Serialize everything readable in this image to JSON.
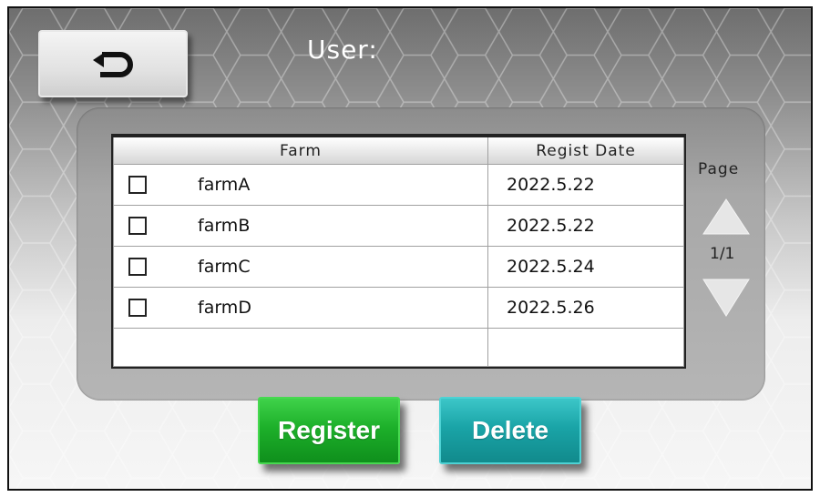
{
  "header": {
    "user_label": "User:"
  },
  "back_button": {
    "icon": "return-arrow-icon"
  },
  "table": {
    "columns": [
      "Farm",
      "Regist Date"
    ],
    "rows": [
      {
        "farm": "farmA",
        "date": "2022.5.22",
        "checked": false
      },
      {
        "farm": "farmB",
        "date": "2022.5.22",
        "checked": false
      },
      {
        "farm": "farmC",
        "date": "2022.5.24",
        "checked": false
      },
      {
        "farm": "farmD",
        "date": "2022.5.26",
        "checked": false
      }
    ]
  },
  "pager": {
    "label": "Page",
    "count": "1/1"
  },
  "actions": {
    "register_label": "Register",
    "delete_label": "Delete"
  },
  "colors": {
    "register": "#1db02a",
    "delete": "#1aa4a7",
    "panel": "#a8a8a8"
  }
}
